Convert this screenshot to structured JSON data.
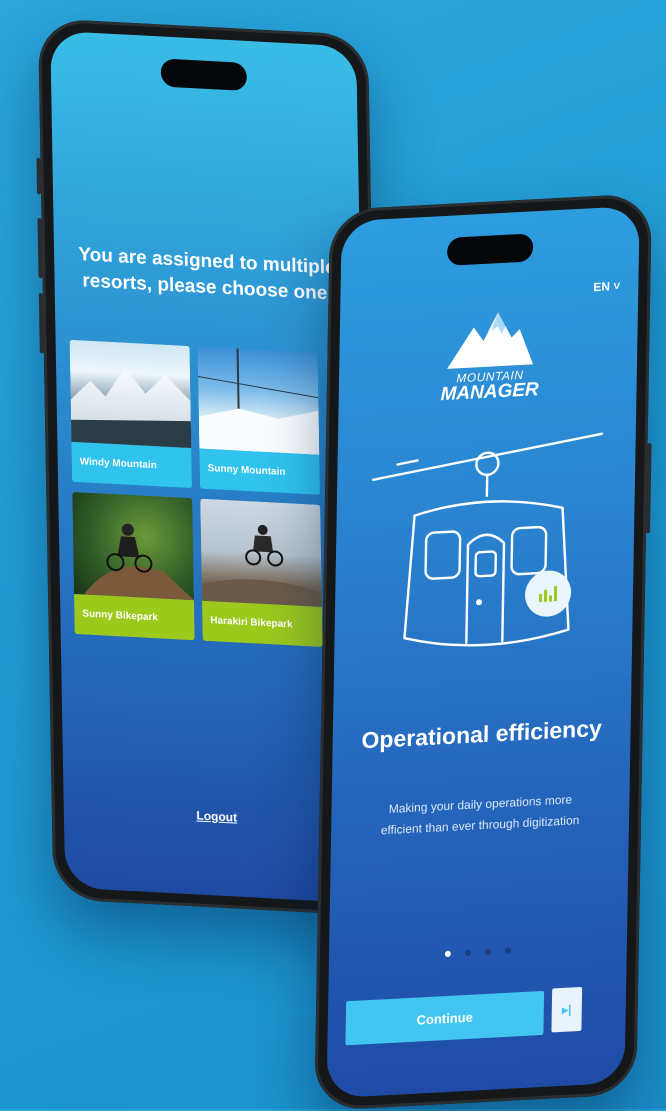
{
  "resort_picker": {
    "title": "You are assigned to multiple resorts, please choose one.",
    "resorts": [
      {
        "name": "Windy Mountain",
        "accent": "#2fc3ee"
      },
      {
        "name": "Sunny Mountain",
        "accent": "#2fc3ee"
      },
      {
        "name": "Sunny Bikepark",
        "accent": "#9cc91c"
      },
      {
        "name": "Harakiri Bikepark",
        "accent": "#9cc91c"
      }
    ],
    "logout_label": "Logout"
  },
  "onboarding": {
    "language": "EN",
    "logo": {
      "line1": "MOUNTAIN",
      "line2": "MANAGER"
    },
    "heading": "Operational efficiency",
    "description": "Making your daily operations more efficient than ever through digitization",
    "continue_label": "Continue",
    "skip_label": "▸|",
    "pagination": {
      "total": 4,
      "current": 1
    }
  },
  "colors": {
    "primary": "#42c6f1",
    "green": "#9cc91c"
  }
}
